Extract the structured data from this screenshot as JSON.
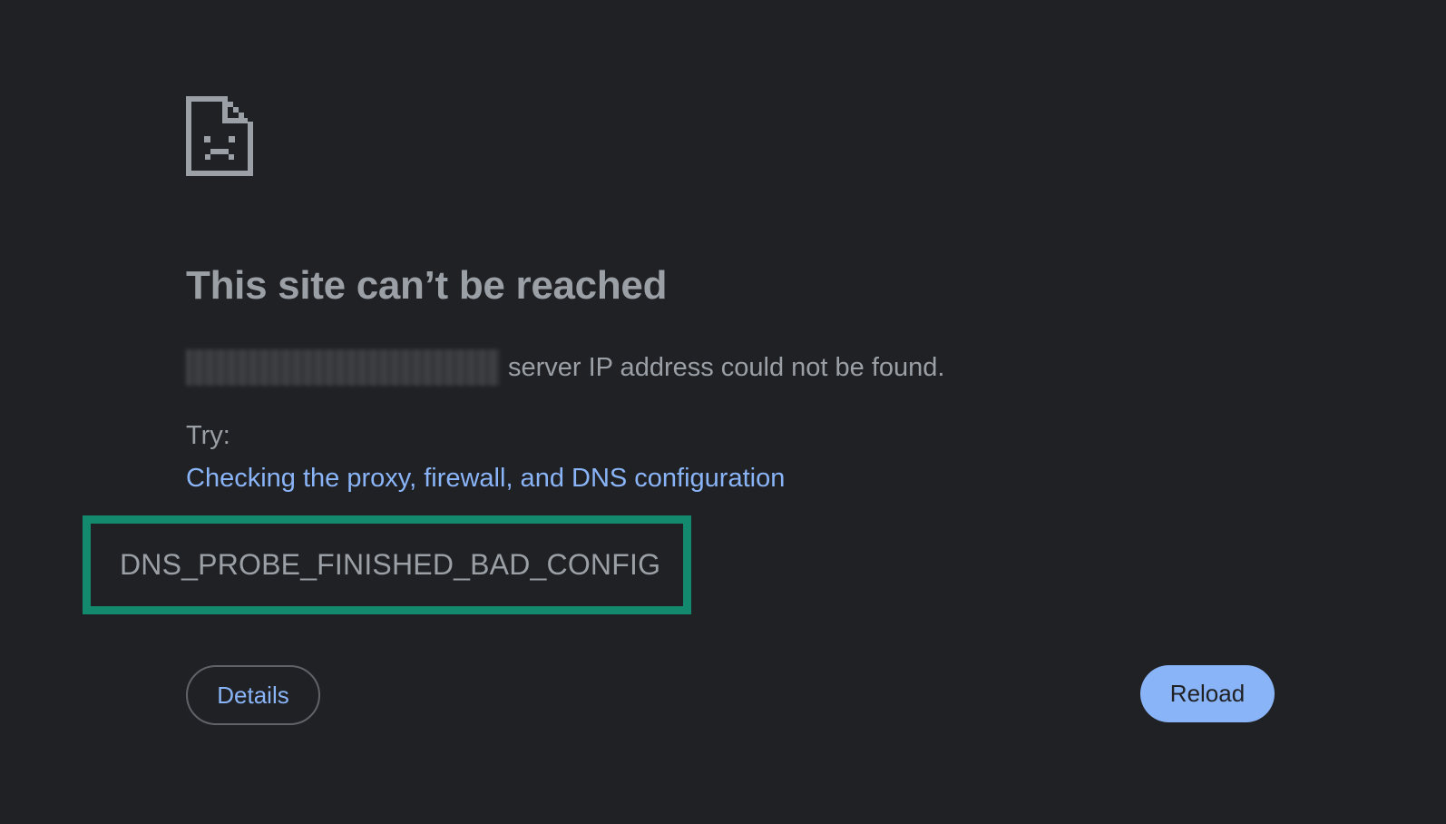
{
  "error_page": {
    "icon": "sad-document-icon",
    "title": "This site can’t be reached",
    "summary_suffix": "server IP address could not be found.",
    "try_label": "Try:",
    "suggestion": "Checking the proxy, firewall, and DNS configuration",
    "error_code": "DNS_PROBE_FINISHED_BAD_CONFIG"
  },
  "buttons": {
    "details_label": "Details",
    "reload_label": "Reload"
  },
  "colors": {
    "background": "#202124",
    "text": "#9aa0a6",
    "link": "#8ab4f8",
    "highlight_border": "#138a6e",
    "reload_bg": "#8ab4f8"
  }
}
